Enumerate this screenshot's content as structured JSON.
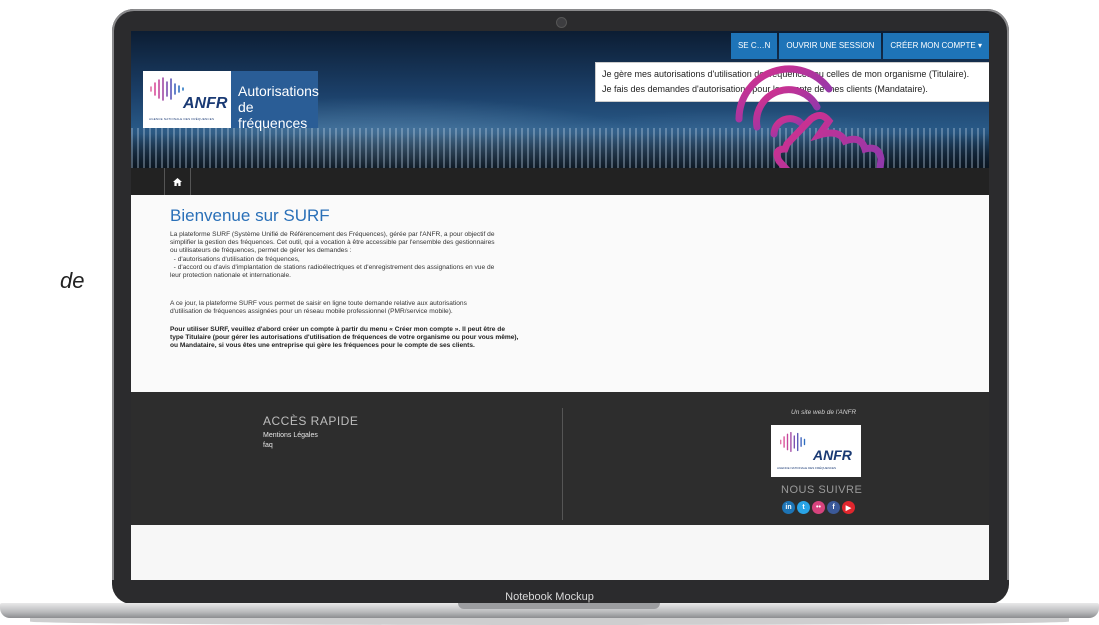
{
  "side_fragment": "de",
  "mockup_label": "Notebook Mockup",
  "header": {
    "logo_name": "ANFR",
    "logo_subtitle": "AGENCE NATIONALE DES FRÉQUENCES",
    "logo_title_line1": "Autorisations",
    "logo_title_line2": "de fréquences",
    "buttons": {
      "login": "SE C…N",
      "open_session": "OUVRIR UNE SESSION",
      "create_account": "CRÉER MON COMPTE"
    },
    "dropdown": [
      "Je gère mes autorisations d'utilisation de fréquences ou celles de mon organisme (Titulaire).",
      "Je fais des demandes d'autorisations pour le compte de mes clients (Mandataire)."
    ]
  },
  "nav": {
    "home_icon": "home-icon"
  },
  "main": {
    "title": "Bienvenue sur SURF",
    "intro": [
      "La plateforme SURF (Système Unifié de Référencement des Fréquences), gérée par l'ANFR, a pour objectif de",
      "simplifier la gestion des fréquences. Cet outil, qui a vocation à être accessible par l'ensemble des gestionnaires",
      "ou utilisateurs de fréquences, permet de gérer les demandes :",
      "  - d'autorisations d'utilisation de fréquences,",
      "  - d'accord ou d'avis d'implantation de stations radioélectriques et d'enregistrement des assignations en vue de",
      "leur protection nationale et internationale."
    ],
    "second": [
      "A ce jour, la plateforme SURF vous permet de saisir en ligne toute demande relative aux autorisations",
      "d'utilisation de fréquences assignées pour un réseau mobile professionnel (PMR/service mobile)."
    ],
    "bold": [
      "Pour utiliser SURF, veuillez d'abord créer un compte à partir du menu « Créer mon compte ». Il peut être de",
      "type Titulaire (pour gérer les autorisations d'utilisation de fréquences de votre organisme ou pour vous même),",
      "ou Mandataire, si vous êtes une entreprise qui gère les fréquences pour le compte de ses clients."
    ]
  },
  "footer": {
    "acces_title": "ACCÈS RAPIDE",
    "links": [
      "Mentions Légales",
      "faq"
    ],
    "site_web": "Un site web de l'ANFR",
    "logo_name": "ANFR",
    "logo_subtitle": "AGENCE NATIONALE DES FRÉQUENCES",
    "suivre": "NOUS SUIVRE",
    "socials": [
      {
        "name": "linkedin-icon",
        "glyph": "in",
        "color": "#1d74b5"
      },
      {
        "name": "twitter-icon",
        "glyph": "t",
        "color": "#29a3e6"
      },
      {
        "name": "flickr-icon",
        "glyph": "••",
        "color": "#d6437d"
      },
      {
        "name": "facebook-icon",
        "glyph": "f",
        "color": "#3b5998"
      },
      {
        "name": "youtube-icon",
        "glyph": "▶",
        "color": "#e0262d"
      }
    ]
  },
  "colors": {
    "accent": "#1e74b8",
    "title_blue": "#2a70b8",
    "dark_bar": "#222222",
    "footer_bg": "#2d2d2d"
  }
}
